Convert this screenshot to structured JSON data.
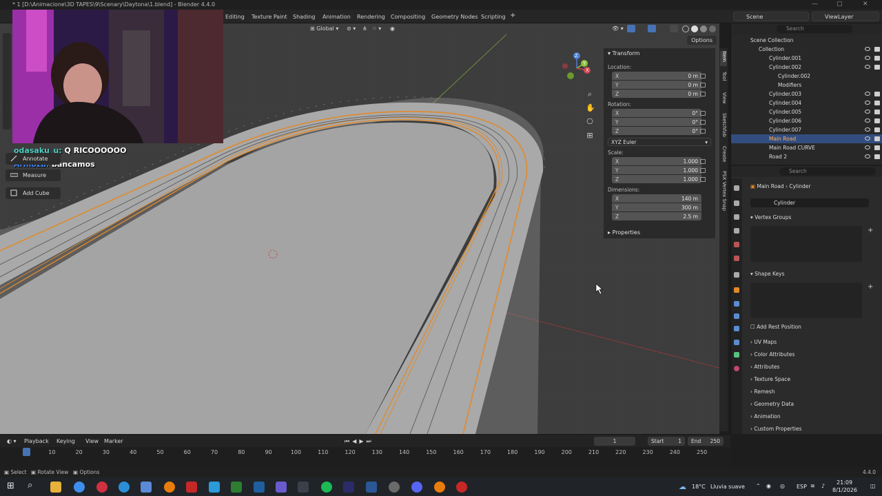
{
  "window": {
    "title": "* 1 [D:\\Animacione\\3D TAPES\\9\\Scenary\\Daytona\\1.blend] - Blender 4.4.0"
  },
  "workspaces": [
    "Editing",
    "Texture Paint",
    "Shading",
    "Animation",
    "Rendering",
    "Compositing",
    "Geometry Nodes",
    "Scripting"
  ],
  "scene": {
    "name": "Scene",
    "view_layer": "ViewLayer"
  },
  "viewport_header": {
    "orientation": "Global",
    "options_label": "Options"
  },
  "chat": [
    {
      "user": "odasaku_u:",
      "message": "Q RICOOOOOO"
    },
    {
      "user": "Armoza:",
      "message": "bancamos"
    }
  ],
  "toolbar": {
    "annotate": "Annotate",
    "measure": "Measure",
    "add_cube": "Add Cube"
  },
  "gizmo": {
    "x": "X",
    "y": "Y",
    "z": "Z"
  },
  "npanel": {
    "tabs": [
      "Item",
      "Tool",
      "View",
      "Sketchfab",
      "Create",
      "PSX Vertex Snap"
    ],
    "transform_header": "Transform",
    "location_label": "Location:",
    "location": [
      {
        "axis": "X",
        "value": "0 m"
      },
      {
        "axis": "Y",
        "value": "0 m"
      },
      {
        "axis": "Z",
        "value": "0 m"
      }
    ],
    "rotation_label": "Rotation:",
    "rotation": [
      {
        "axis": "X",
        "value": "0°"
      },
      {
        "axis": "Y",
        "value": "0°"
      },
      {
        "axis": "Z",
        "value": "0°"
      }
    ],
    "rotation_mode": "XYZ Euler",
    "scale_label": "Scale:",
    "scale": [
      {
        "axis": "X",
        "value": "1.000"
      },
      {
        "axis": "Y",
        "value": "1.000"
      },
      {
        "axis": "Z",
        "value": "1.000"
      }
    ],
    "dimensions_label": "Dimensions:",
    "dimensions": [
      {
        "axis": "X",
        "value": "140 m"
      },
      {
        "axis": "Y",
        "value": "300 m"
      },
      {
        "axis": "Z",
        "value": "2.5 m"
      }
    ],
    "properties_header": "Properties"
  },
  "outliner": {
    "search_placeholder": "Search",
    "rows": [
      {
        "name": "Scene Collection",
        "indent": 0,
        "selected": false
      },
      {
        "name": "Collection",
        "indent": 1,
        "selected": false
      },
      {
        "name": "Cylinder.001",
        "indent": 2,
        "selected": false
      },
      {
        "name": "Cylinder.002",
        "indent": 2,
        "selected": false
      },
      {
        "name": "Cylinder.002",
        "indent": 3,
        "selected": false
      },
      {
        "name": "Modifiers",
        "indent": 3,
        "selected": false
      },
      {
        "name": "Cylinder.003",
        "indent": 2,
        "selected": false
      },
      {
        "name": "Cylinder.004",
        "indent": 2,
        "selected": false
      },
      {
        "name": "Cylinder.005",
        "indent": 2,
        "selected": false
      },
      {
        "name": "Cylinder.006",
        "indent": 2,
        "selected": false
      },
      {
        "name": "Cylinder.007",
        "indent": 2,
        "selected": false
      },
      {
        "name": "Main Road",
        "indent": 2,
        "selected": true
      },
      {
        "name": "Main Road CURVE",
        "indent": 2,
        "selected": false
      },
      {
        "name": "Road 2",
        "indent": 2,
        "selected": false
      }
    ]
  },
  "properties": {
    "search_placeholder": "Search",
    "breadcrumb_object": "Main Road",
    "breadcrumb_data": "Cylinder",
    "data_name": "Cylinder",
    "vertex_groups": "Vertex Groups",
    "shape_keys": "Shape Keys",
    "add_rest_position": "Add Rest Position",
    "sections": [
      "UV Maps",
      "Color Attributes",
      "Attributes",
      "Texture Space",
      "Remesh",
      "Geometry Data",
      "Animation",
      "Custom Properties"
    ]
  },
  "timeline": {
    "playback": "Playback",
    "keying": "Keying",
    "view": "View",
    "marker": "Marker",
    "current_frame": "1",
    "start_label": "Start",
    "start": "1",
    "end_label": "End",
    "end": "250",
    "ticks": [
      "1",
      "10",
      "20",
      "30",
      "40",
      "50",
      "60",
      "70",
      "80",
      "90",
      "100",
      "110",
      "120",
      "130",
      "140",
      "150",
      "160",
      "170",
      "180",
      "190",
      "200",
      "210",
      "220",
      "230",
      "240",
      "250"
    ]
  },
  "statusbar": {
    "select": "Select",
    "rotate_view": "Rotate View",
    "options": "Options",
    "version": "4.4.0"
  },
  "taskbar": {
    "weather_temp": "18°C",
    "weather_desc": "Lluvia suave",
    "language": "ESP",
    "time": "21:09",
    "date": "8/1/2026"
  }
}
